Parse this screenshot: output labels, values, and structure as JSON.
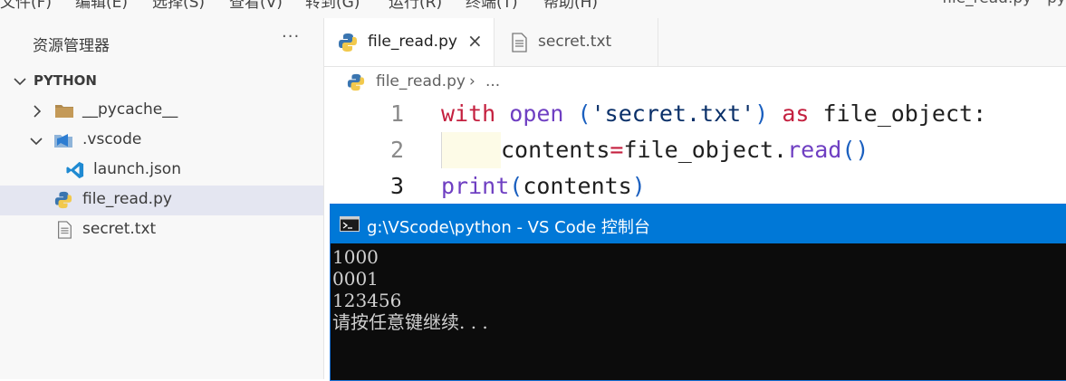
{
  "menubar": {
    "items": [
      "文件(F)",
      "编辑(E)",
      "选择(S)",
      "查看(V)",
      "转到(G)",
      "运行(R)",
      "终端(T)",
      "帮助(H)"
    ],
    "window_title": "file_read.py - py"
  },
  "sidebar": {
    "title": "资源管理器",
    "more": "···",
    "section": "PYTHON",
    "items": [
      {
        "label": "__pycache__",
        "icon": "folder-icon",
        "chevron": "›"
      },
      {
        "label": ".vscode",
        "icon": "vscode-folder-icon",
        "chevron": "⌄"
      },
      {
        "label": "launch.json",
        "icon": "vscode-icon"
      },
      {
        "label": "file_read.py",
        "icon": "python-icon"
      },
      {
        "label": "secret.txt",
        "icon": "text-file-icon"
      }
    ]
  },
  "tabs": [
    {
      "label": "file_read.py",
      "icon": "python-icon",
      "close": "×"
    },
    {
      "label": "secret.txt",
      "icon": "text-file-icon"
    }
  ],
  "breadcrumb": {
    "file": "file_read.py",
    "sep": "›",
    "more": "..."
  },
  "code": {
    "line_numbers": [
      "1",
      "2",
      "3"
    ],
    "line1": {
      "t1": "with",
      "t2": " ",
      "t3": "open",
      "t4": " (",
      "t5": "'secret.txt'",
      "t6": ") ",
      "t7": "as",
      "t8": " file_object:"
    },
    "line2": {
      "t1": "contents",
      "t2": "=",
      "t3": "file_object.",
      "t4": "read",
      "t5": "()"
    },
    "line3": {
      "t1": "print",
      "t2": "(",
      "t3": "contents",
      "t4": ")"
    }
  },
  "console": {
    "title": "g:\\VScode\\python - VS Code 控制台",
    "output": [
      "1000",
      "0001",
      "123456",
      "请按任意键继续. . ."
    ]
  },
  "colors": {
    "keyword": "#c4203f",
    "builtin": "#6f3fc2",
    "string": "#0a3069",
    "console_title": "#0078d7",
    "selection": "#e4e6f1"
  }
}
